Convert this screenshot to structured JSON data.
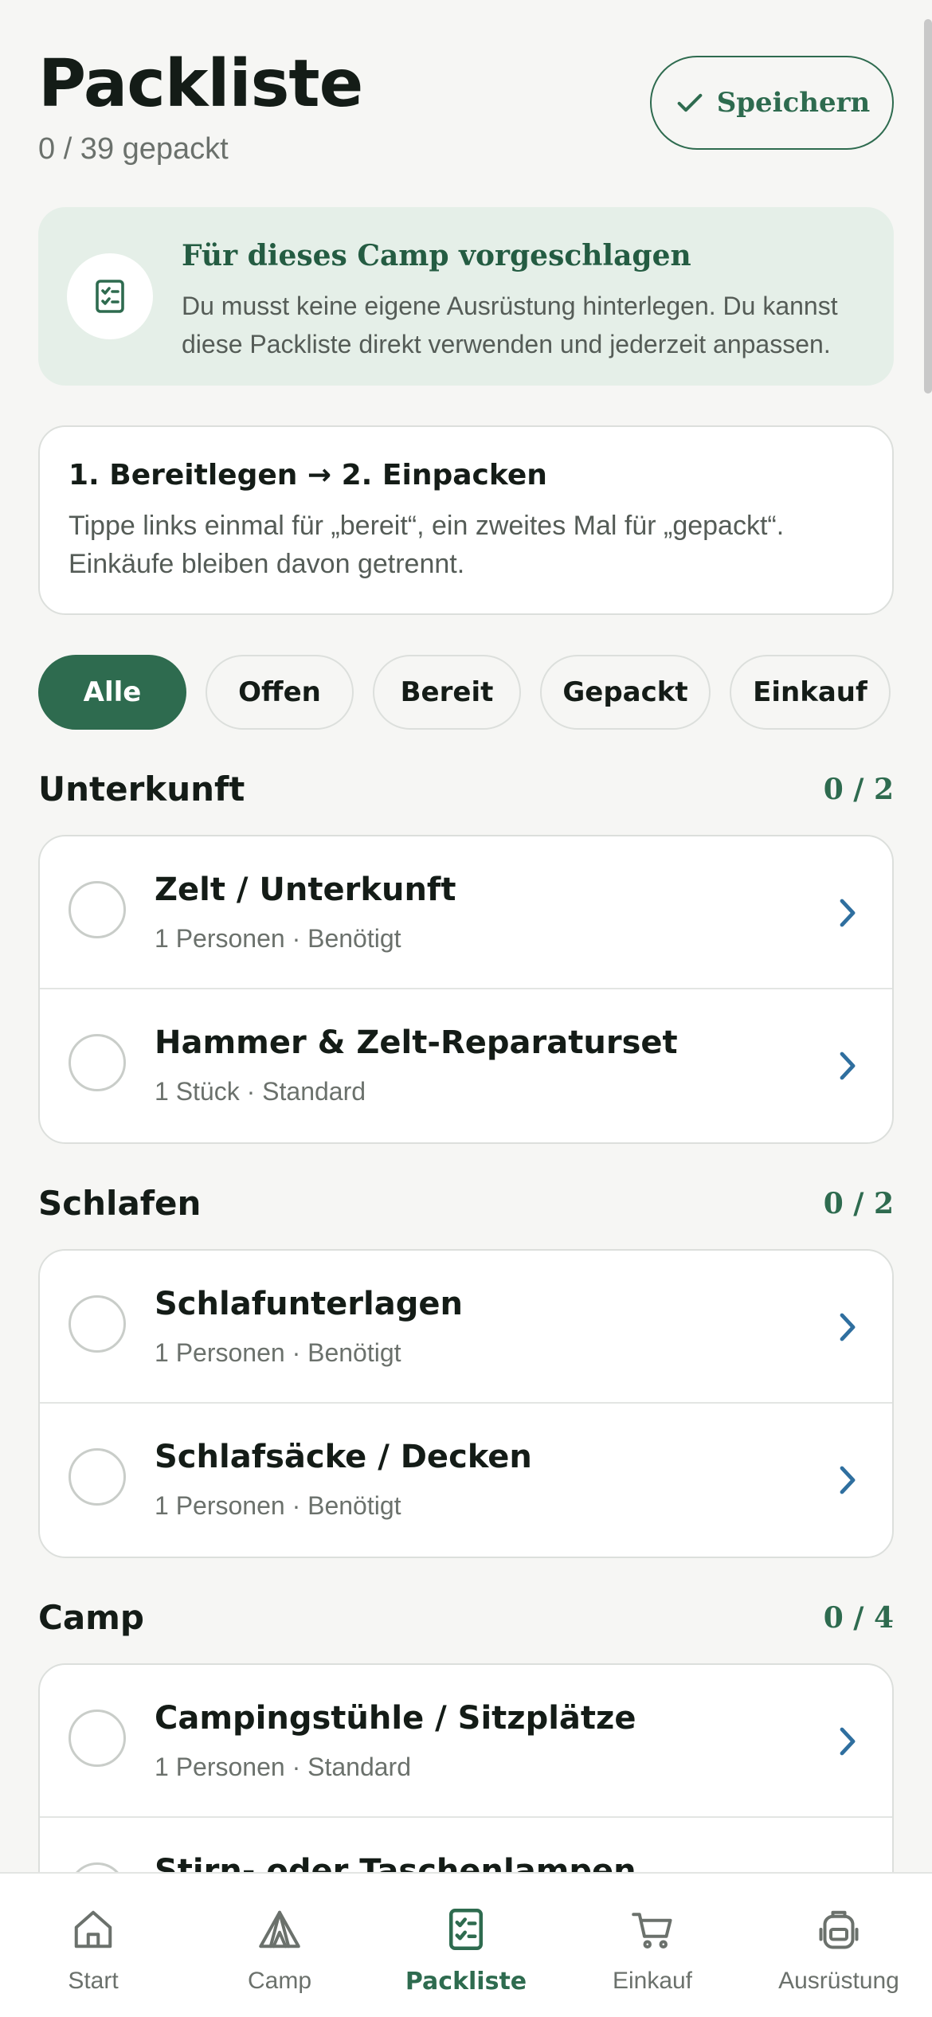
{
  "header": {
    "title": "Packliste",
    "progress_text": "0 / 39 gepackt",
    "save_label": "Speichern"
  },
  "suggestion": {
    "title": "Für dieses Camp vorgeschlagen",
    "text": "Du musst keine eigene Ausrüstung hinterlegen. Du kannst diese Packliste direkt verwenden und jederzeit anpassen."
  },
  "steps": {
    "title": "1. Bereitlegen → 2. Einpacken",
    "text": "Tippe links einmal für „bereit“, ein zweites Mal für „gepackt“. Einkäufe bleiben davon getrennt."
  },
  "filters": [
    "Alle",
    "Offen",
    "Bereit",
    "Gepackt",
    "Einkauf"
  ],
  "active_filter": "Alle",
  "sections": [
    {
      "title": "Unterkunft",
      "count": "0 / 2",
      "items": [
        {
          "title": "Zelt / Unterkunft",
          "meta": "1 Personen · Benötigt"
        },
        {
          "title": "Hammer & Zelt-Reparaturset",
          "meta": "1 Stück · Standard"
        }
      ]
    },
    {
      "title": "Schlafen",
      "count": "0 / 2",
      "items": [
        {
          "title": "Schlafunterlagen",
          "meta": "1 Personen · Benötigt"
        },
        {
          "title": "Schlafsäcke / Decken",
          "meta": "1 Personen · Benötigt"
        }
      ]
    },
    {
      "title": "Camp",
      "count": "0 / 4",
      "items": [
        {
          "title": "Campingstühle / Sitzplätze",
          "meta": "1 Personen · Standard"
        },
        {
          "title": "Stirn- oder Taschenlampen",
          "meta": ""
        }
      ]
    }
  ],
  "nav": [
    {
      "label": "Start",
      "icon": "home-icon"
    },
    {
      "label": "Camp",
      "icon": "tent-icon"
    },
    {
      "label": "Packliste",
      "icon": "checklist-icon",
      "active": true
    },
    {
      "label": "Einkauf",
      "icon": "cart-icon"
    },
    {
      "label": "Ausrüstung",
      "icon": "backpack-icon"
    }
  ],
  "colors": {
    "accent": "#2e6b4f",
    "background": "#f6f6f4",
    "suggestion_bg": "#e5efe8",
    "chevron": "#2f6f9f"
  }
}
